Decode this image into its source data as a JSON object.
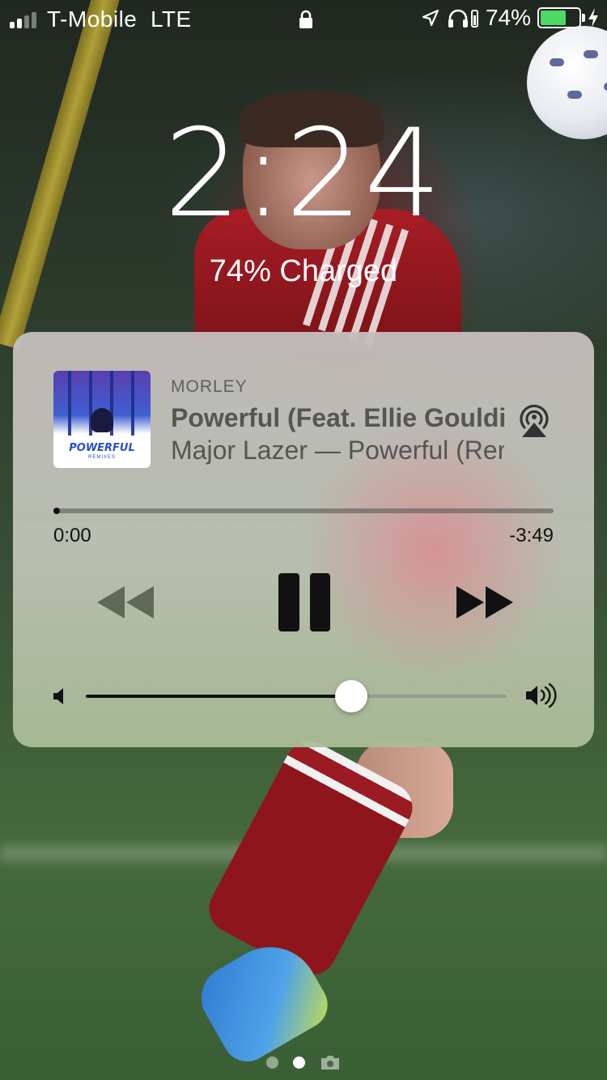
{
  "status_bar": {
    "carrier": "T-Mobile",
    "network": "LTE",
    "signal_bars": 2,
    "battery_percent": "74%",
    "battery_level": 0.74,
    "battery_color": "#4cd964",
    "icons": [
      "lock-icon",
      "location-icon",
      "headphones-icon",
      "battery-icon",
      "charging-bolt-icon"
    ]
  },
  "lockscreen": {
    "time": "2:24",
    "charge_status": "74% Charged"
  },
  "now_playing": {
    "source": "MORLEY",
    "title": "Powerful (Feat. Ellie Goulding)",
    "subtitle": "Major Lazer — Powerful (Remixes)",
    "album_art": {
      "title": "POWERFUL",
      "subtitle": "REMIXES"
    },
    "elapsed": "0:00",
    "remaining": "-3:49",
    "progress_fraction": 0.0,
    "volume_fraction": 0.63,
    "controls": {
      "rewind": "rewind-icon",
      "pause": "pause-icon",
      "forward": "fast-forward-icon",
      "airplay": "airplay-icon"
    }
  },
  "pager": {
    "pages": 2,
    "active_page": 2,
    "trailing_icon": "camera-icon"
  }
}
